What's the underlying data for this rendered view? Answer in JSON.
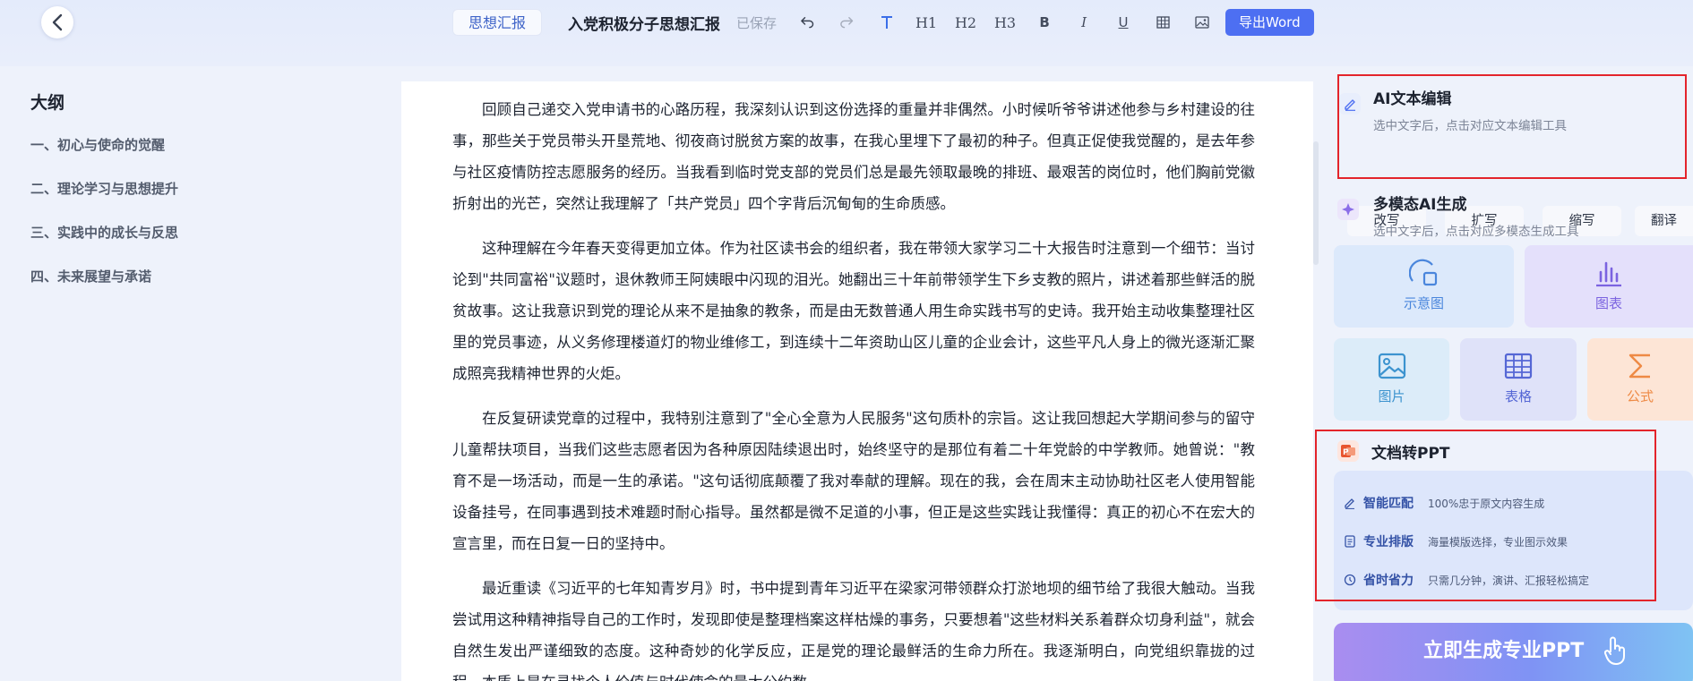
{
  "header": {
    "doc_type": "思想汇报",
    "title": "入党积极分子思想汇报",
    "save_status": "已保存",
    "tools": {
      "h1": "H1",
      "h2": "H2",
      "h3": "H3",
      "bold": "B",
      "italic": "I",
      "underline": "U"
    },
    "export_label": "导出Word"
  },
  "outline": {
    "title": "大纲",
    "items": [
      "一、初心与使命的觉醒",
      "二、理论学习与思想提升",
      "三、实践中的成长与反思",
      "四、未来展望与承诺"
    ]
  },
  "document": {
    "paragraphs": [
      "回顾自己递交入党申请书的心路历程，我深刻认识到这份选择的重量并非偶然。小时候听爷爷讲述他参与乡村建设的往事，那些关于党员带头开垦荒地、彻夜商讨脱贫方案的故事，在我心里埋下了最初的种子。但真正促使我觉醒的，是去年参与社区疫情防控志愿服务的经历。当我看到临时党支部的党员们总是最先领取最晚的排班、最艰苦的岗位时，他们胸前党徽折射出的光芒，突然让我理解了「共产党员」四个字背后沉甸甸的生命质感。",
      "这种理解在今年春天变得更加立体。作为社区读书会的组织者，我在带领大家学习二十大报告时注意到一个细节：当讨论到\"共同富裕\"议题时，退休教师王阿姨眼中闪现的泪光。她翻出三十年前带领学生下乡支教的照片，讲述着那些鲜活的脱贫故事。这让我意识到党的理论从来不是抽象的教条，而是由无数普通人用生命实践书写的史诗。我开始主动收集整理社区里的党员事迹，从义务修理楼道灯的物业维修工，到连续十二年资助山区儿童的企业会计，这些平凡人身上的微光逐渐汇聚成照亮我精神世界的火炬。",
      "在反复研读党章的过程中，我特别注意到了\"全心全意为人民服务\"这句质朴的宗旨。这让我回想起大学期间参与的留守儿童帮扶项目，当我们这些志愿者因为各种原因陆续退出时，始终坚守的是那位有着二十年党龄的中学教师。她曾说：\"教育不是一场活动，而是一生的承诺。\"这句话彻底颠覆了我对奉献的理解。现在的我，会在周末主动协助社区老人使用智能设备挂号，在同事遇到技术难题时耐心指导。虽然都是微不足道的小事，但正是这些实践让我懂得：真正的初心不在宏大的宣言里，而在日复一日的坚持中。",
      "最近重读《习近平的七年知青岁月》时，书中提到青年习近平在梁家河带领群众打淤地坝的细节给了我很大触动。当我尝试用这种精神指导自己的工作时，发现即使是整理档案这样枯燥的事务，只要想着\"这些材料关系着群众切身利益\"，就会自然生发出严谨细致的态度。这种奇妙的化学反应，正是党的理论最鲜活的生命力所在。我逐渐明白，向党组织靠拢的过程，本质上是在寻找个人价值与时代使命的最大公约数。"
    ]
  },
  "panel": {
    "ai_edit": {
      "title": "AI文本编辑",
      "subtitle": "选中文字后，点击对应文本编辑工具",
      "buttons": [
        "改写",
        "扩写",
        "缩写",
        "翻译"
      ]
    },
    "multimodal": {
      "title": "多模态AI生成",
      "subtitle": "选中文字后，点击对应多模态生成工具",
      "tiles": [
        "示意图",
        "图表",
        "图片",
        "表格",
        "公式"
      ]
    },
    "ppt": {
      "title": "文档转PPT",
      "features": [
        {
          "title": "智能匹配",
          "desc": "100%忠于原文内容生成"
        },
        {
          "title": "专业排版",
          "desc": "海量模版选择，专业图示效果"
        },
        {
          "title": "省时省力",
          "desc": "只需几分钟，演讲、汇报轻松搞定"
        }
      ],
      "cta": "立即生成专业PPT"
    }
  },
  "colors": {
    "accent": "#4d6ff2",
    "highlight_border": "#e3242b",
    "tile_blue": "#dce9fb",
    "tile_purple": "#e4e0fb",
    "tile_orange": "#fde5d6"
  }
}
